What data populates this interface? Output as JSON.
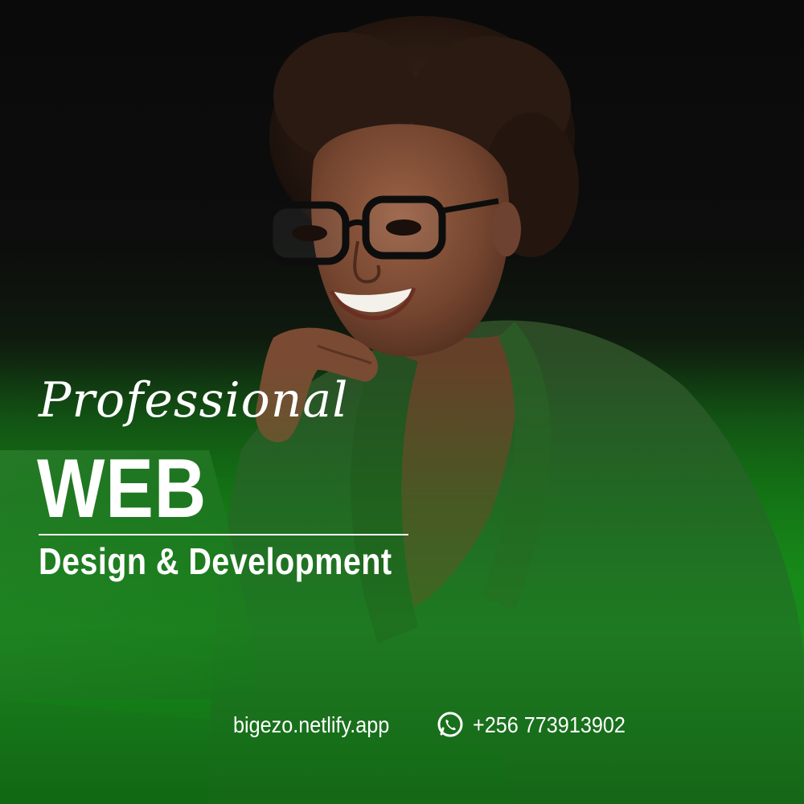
{
  "headline": {
    "script_word": "Professional",
    "main_word": "WEB",
    "subtitle": "Design & Development"
  },
  "footer": {
    "website": "bigezo.netlify.app",
    "phone": "+256 773913902",
    "phone_icon": "whatsapp-icon"
  },
  "colors": {
    "background_dark": "#0a0a0a",
    "brand_green": "#178a18",
    "text": "#ffffff",
    "blazer_green": "#2f5a2a",
    "skin": "#7a4a33"
  }
}
